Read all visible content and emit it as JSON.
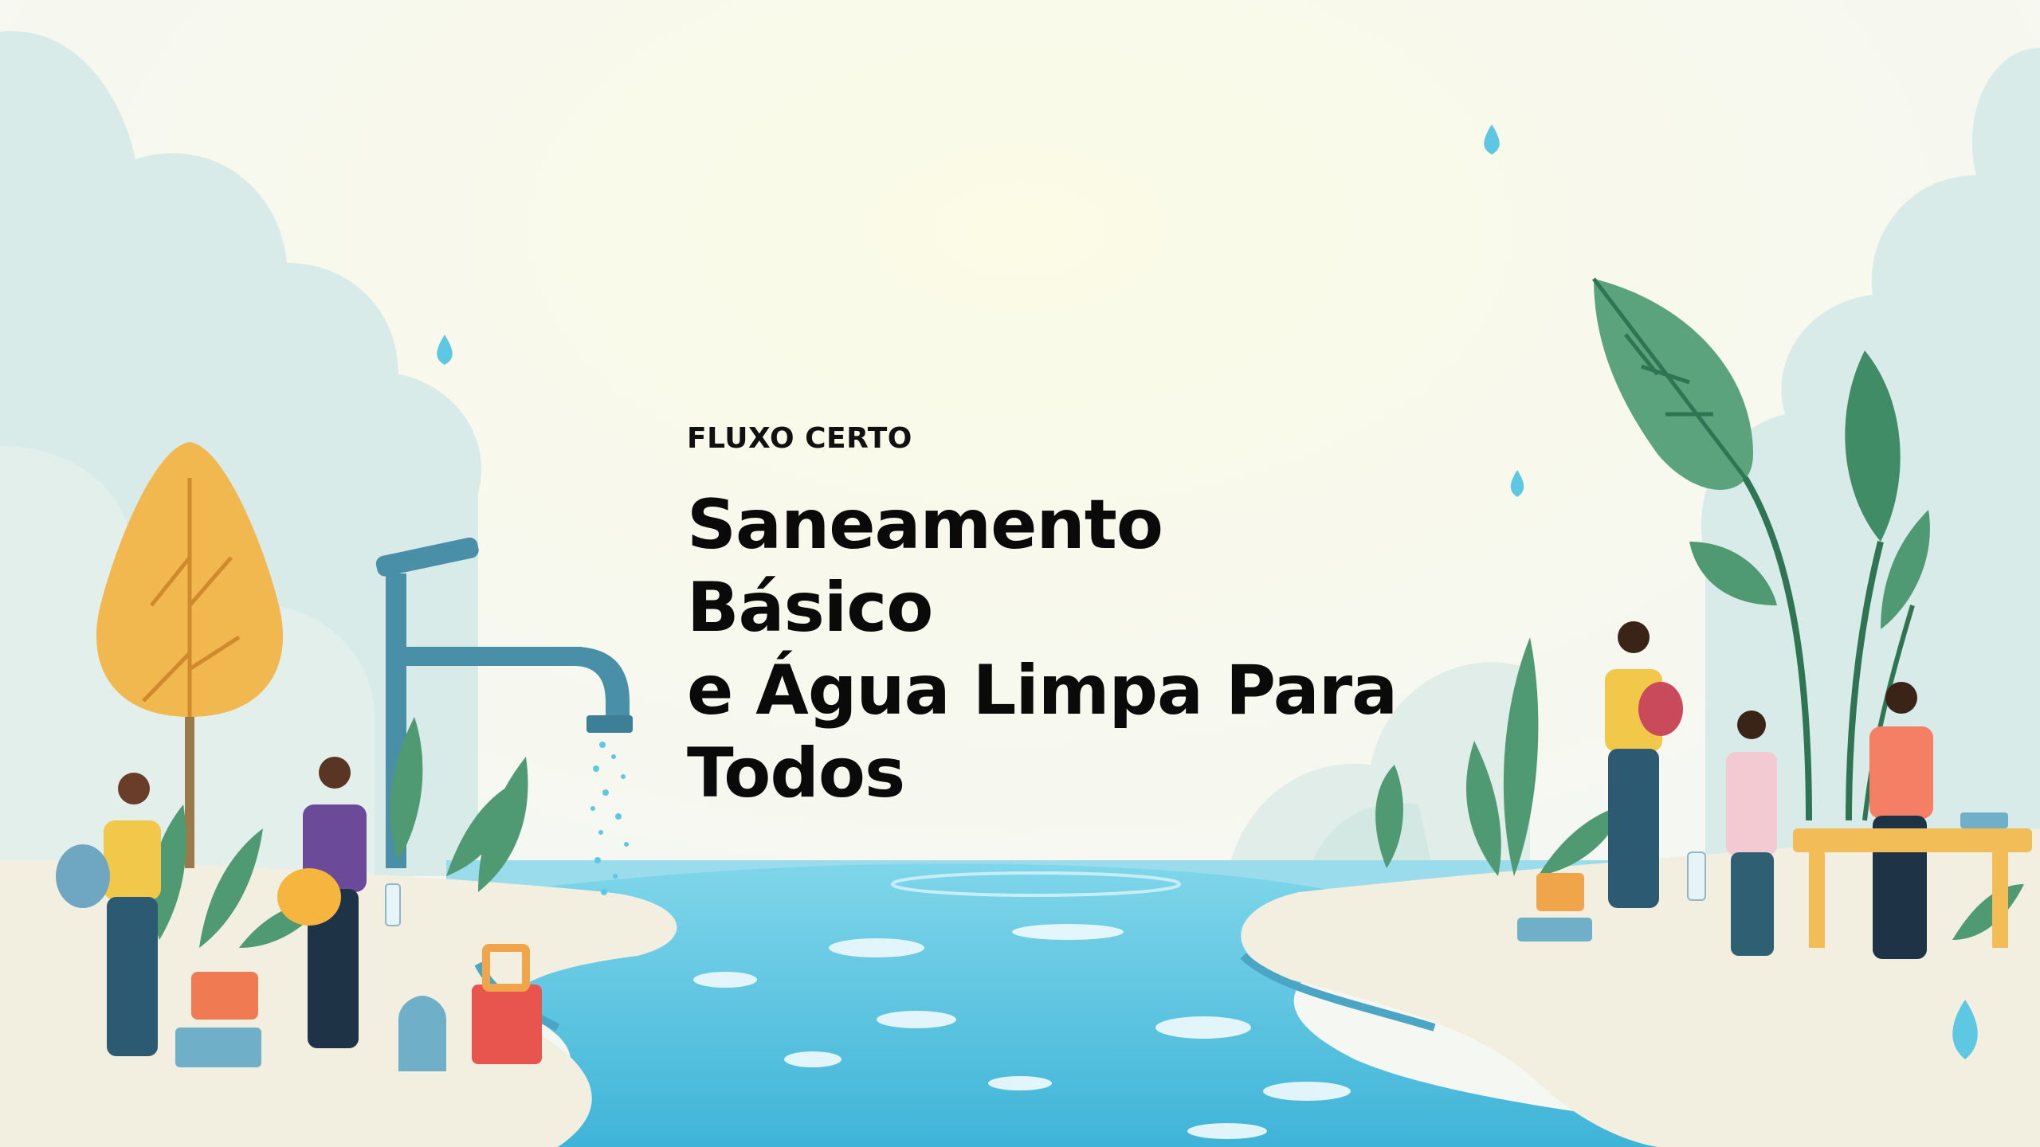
{
  "slide": {
    "kicker": "FLUXO CERTO",
    "title_line_1": "Saneamento Básico",
    "title_line_2": "e Água Limpa Para",
    "title_line_3": "Todos"
  },
  "palette": {
    "background": "#f6f7f1",
    "water": "#5ec8e3",
    "leaf": "#4f9a72",
    "tree": "#f1b84f",
    "faucet": "#4a8fa8",
    "text": "#0a0a0a"
  },
  "illustration": {
    "elements": [
      "tree",
      "faucet",
      "river",
      "water-drops",
      "leaves",
      "people",
      "containers",
      "table"
    ]
  }
}
